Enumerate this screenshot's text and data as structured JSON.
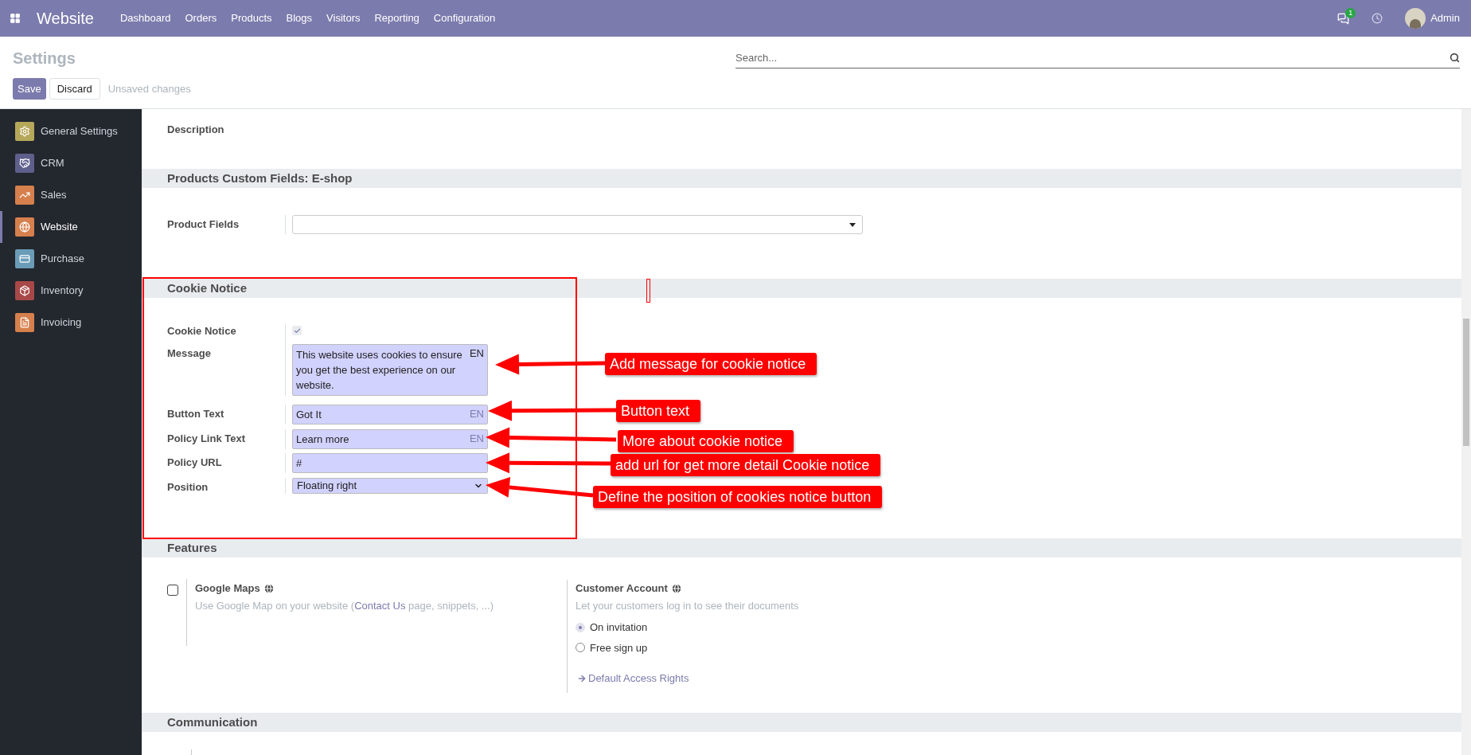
{
  "navbar": {
    "app_name": "Website",
    "menu": [
      "Dashboard",
      "Orders",
      "Products",
      "Blogs",
      "Visitors",
      "Reporting",
      "Configuration"
    ],
    "messages_badge": "1",
    "user": "Admin"
  },
  "control_panel": {
    "title": "Settings",
    "search_placeholder": "Search...",
    "save": "Save",
    "discard": "Discard",
    "status": "Unsaved changes"
  },
  "sidebar": {
    "items": [
      {
        "label": "General Settings",
        "color": "#b6a85a",
        "selected": false
      },
      {
        "label": "CRM",
        "color": "#5f5f8c",
        "selected": false
      },
      {
        "label": "Sales",
        "color": "#d6804d",
        "selected": false
      },
      {
        "label": "Website",
        "color": "#d6804d",
        "selected": true
      },
      {
        "label": "Purchase",
        "color": "#6a9cb8",
        "selected": false
      },
      {
        "label": "Inventory",
        "color": "#a84848",
        "selected": false
      },
      {
        "label": "Invoicing",
        "color": "#d6804d",
        "selected": false
      }
    ]
  },
  "description_label": "Description",
  "products_custom_fields": {
    "title": "Products Custom Fields: E-shop",
    "field_label": "Product Fields"
  },
  "cookie_notice": {
    "title": "Cookie Notice",
    "enabled_label": "Cookie Notice",
    "enabled": true,
    "fields": [
      {
        "kind": "textarea",
        "label": "Message",
        "value": "This website uses cookies to ensure you get the best experience on our website.",
        "lang": "EN"
      },
      {
        "kind": "text",
        "label": "Button Text",
        "value": "Got It",
        "lang": "EN"
      },
      {
        "kind": "text",
        "label": "Policy Link Text",
        "value": "Learn more",
        "lang": "EN"
      },
      {
        "kind": "text",
        "label": "Policy URL",
        "value": "#"
      },
      {
        "kind": "select",
        "label": "Position",
        "value": "Floating right"
      }
    ]
  },
  "features": {
    "title": "Features",
    "google_maps": {
      "title": "Google Maps",
      "checked": false,
      "description_before": "Use Google Map on your website (",
      "link": "Contact Us",
      "description_after": " page, snippets, ...)"
    },
    "customer_account": {
      "title": "Customer Account",
      "description": "Let your customers log in to see their documents",
      "options": [
        {
          "label": "On invitation",
          "selected": true
        },
        {
          "label": "Free sign up",
          "selected": false
        }
      ],
      "link": "Default Access Rights"
    }
  },
  "communication": {
    "title": "Communication"
  },
  "annotations": [
    {
      "text": "Add message for cookie notice"
    },
    {
      "text": "Button text"
    },
    {
      "text": "More about cookie notice"
    },
    {
      "text": "add url for get more detail Cookie notice"
    },
    {
      "text": "Define the position of cookies notice button"
    }
  ]
}
